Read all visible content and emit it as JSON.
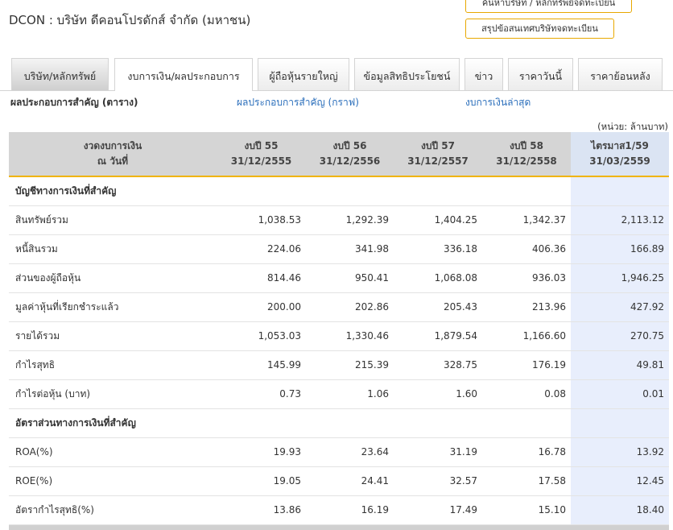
{
  "company_title": "DCON : บริษัท ดีคอนโปรดักส์ จำกัด (มหาชน)",
  "top_buttons": {
    "search": "ค้นหาบริษัท / หลักทรัพย์จดทะเบียน",
    "summary": "สรุปข้อสนเทศบริษัทจดทะเบียน"
  },
  "tabs": [
    {
      "label": "บริษัท/หลักทรัพย์"
    },
    {
      "label": "งบการเงิน/ผลประกอบการ"
    },
    {
      "label": "ผู้ถือหุ้นรายใหญ่"
    },
    {
      "label": "ข้อมูลสิทธิประโยชน์"
    },
    {
      "label": "ข่าว"
    },
    {
      "label": "ราคาวันนี้"
    },
    {
      "label": "ราคาย้อนหลัง"
    }
  ],
  "subnav": {
    "current": "ผลประกอบการสำคัญ (ตาราง)",
    "chart_link": "ผลประกอบการสำคัญ (กราฟ)",
    "latest_link": "งบการเงินล่าสุด"
  },
  "unit_label": "(หน่วย: ล้านบาท)",
  "table": {
    "header": [
      {
        "line1": "งวดงบการเงิน",
        "line2": "ณ วันที่"
      },
      {
        "line1": "งบปี 55",
        "line2": "31/12/2555"
      },
      {
        "line1": "งบปี 56",
        "line2": "31/12/2556"
      },
      {
        "line1": "งบปี 57",
        "line2": "31/12/2557"
      },
      {
        "line1": "งบปี 58",
        "line2": "31/12/2558"
      },
      {
        "line1": "ไตรมาส1/59",
        "line2": "31/03/2559"
      }
    ],
    "section1": "บัญชีทางการเงินที่สำคัญ",
    "rows1": [
      {
        "label": "สินทรัพย์รวม",
        "v": [
          "1,038.53",
          "1,292.39",
          "1,404.25",
          "1,342.37",
          "2,113.12"
        ]
      },
      {
        "label": "หนี้สินรวม",
        "v": [
          "224.06",
          "341.98",
          "336.18",
          "406.36",
          "166.89"
        ]
      },
      {
        "label": "ส่วนของผู้ถือหุ้น",
        "v": [
          "814.46",
          "950.41",
          "1,068.08",
          "936.03",
          "1,946.25"
        ]
      },
      {
        "label": "มูลค่าหุ้นที่เรียกชำระแล้ว",
        "v": [
          "200.00",
          "202.86",
          "205.43",
          "213.96",
          "427.92"
        ]
      },
      {
        "label": "รายได้รวม",
        "v": [
          "1,053.03",
          "1,330.46",
          "1,879.54",
          "1,166.60",
          "270.75"
        ]
      },
      {
        "label": "กำไรสุทธิ",
        "v": [
          "145.99",
          "215.39",
          "328.75",
          "176.19",
          "49.81"
        ]
      },
      {
        "label": "กำไรต่อหุ้น (บาท)",
        "v": [
          "0.73",
          "1.06",
          "1.60",
          "0.08",
          "0.01"
        ]
      }
    ],
    "section2": "อัตราส่วนทางการเงินที่สำคัญ",
    "rows2": [
      {
        "label": "ROA(%)",
        "v": [
          "19.93",
          "23.64",
          "31.19",
          "16.78",
          "13.92"
        ]
      },
      {
        "label": "ROE(%)",
        "v": [
          "19.05",
          "24.41",
          "32.57",
          "17.58",
          "12.45"
        ]
      },
      {
        "label": "อัตรากำไรสุทธิ(%)",
        "v": [
          "13.86",
          "16.19",
          "17.49",
          "15.10",
          "18.40"
        ]
      }
    ]
  }
}
